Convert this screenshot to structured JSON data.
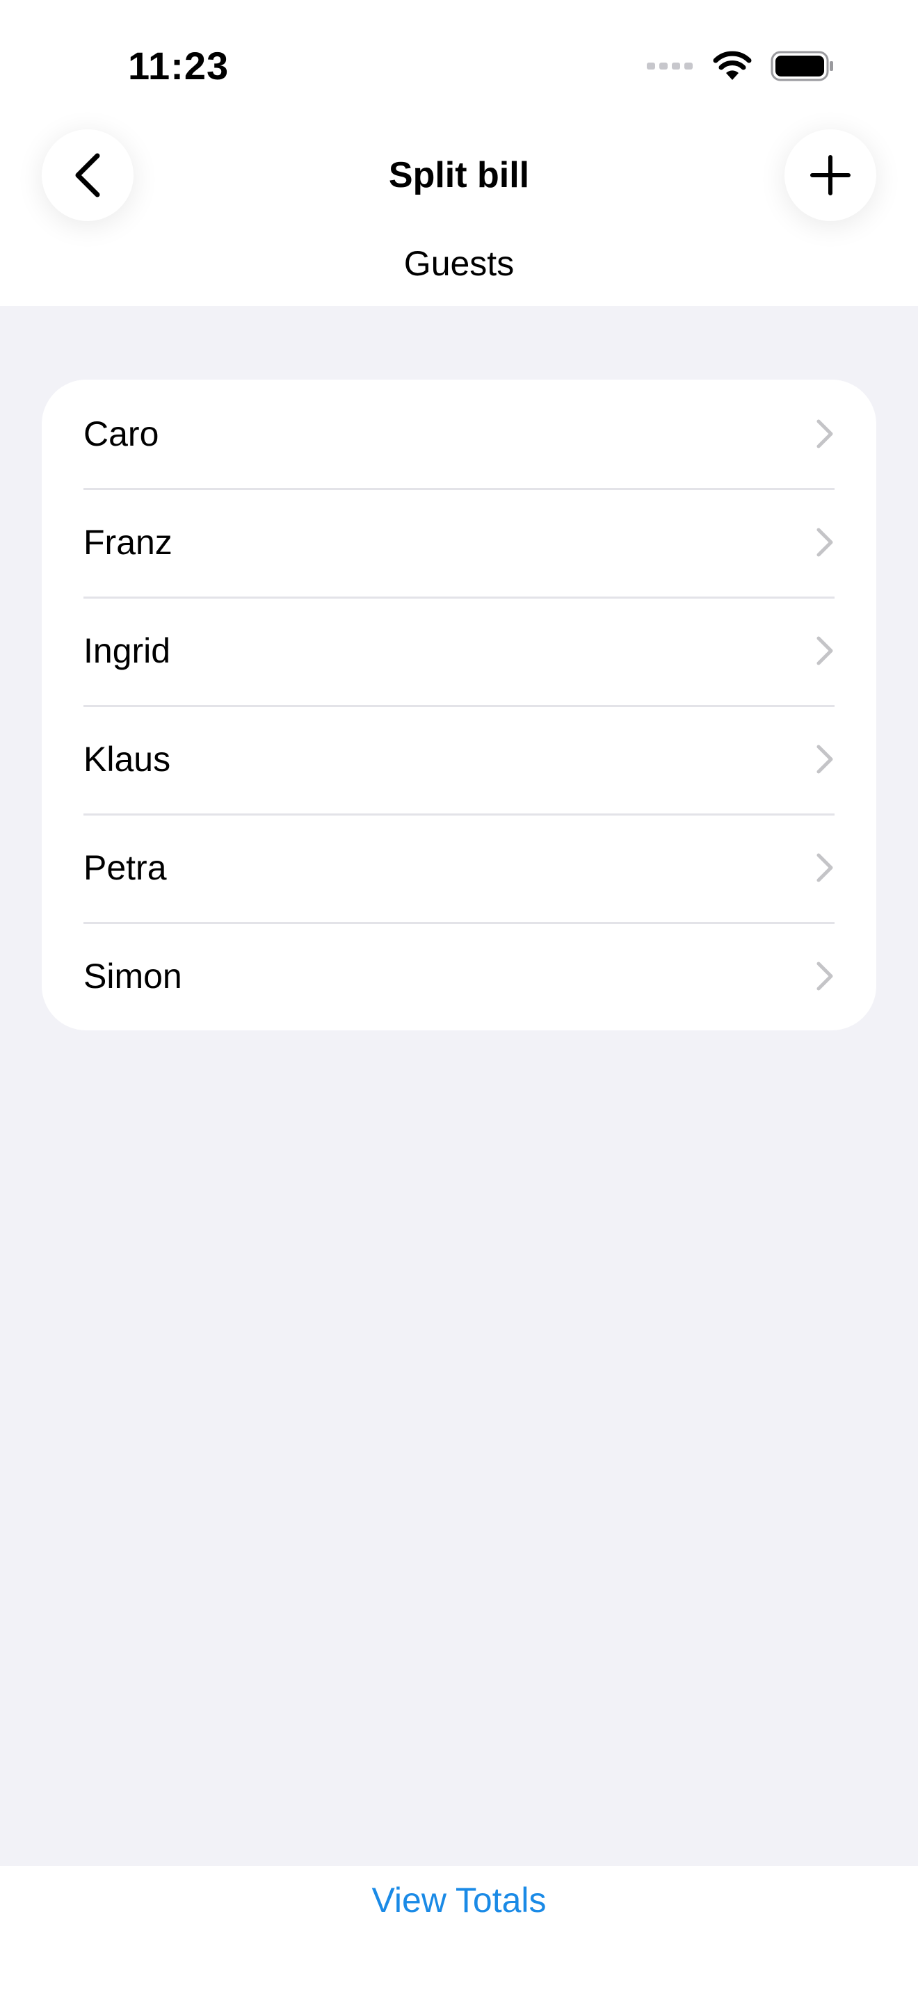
{
  "status_bar": {
    "time": "11:23"
  },
  "nav": {
    "title": "Split bill",
    "back_icon": "chevron-left-icon",
    "add_icon": "plus-icon"
  },
  "section": {
    "header": "Guests"
  },
  "guests": [
    {
      "name": "Caro"
    },
    {
      "name": "Franz"
    },
    {
      "name": "Ingrid"
    },
    {
      "name": "Klaus"
    },
    {
      "name": "Petra"
    },
    {
      "name": "Simon"
    }
  ],
  "footer": {
    "view_totals_label": "View Totals"
  },
  "colors": {
    "accent": "#1a8ae6",
    "background": "#f2f2f7",
    "card": "#ffffff",
    "chevron": "#c4c4c7"
  }
}
